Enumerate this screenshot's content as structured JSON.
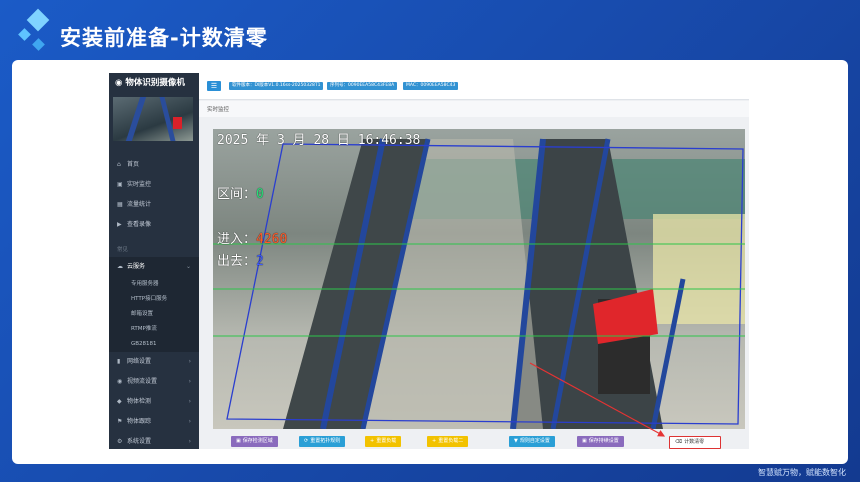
{
  "slide": {
    "title": "安装前准备-计数清零",
    "footer": "智慧赋万物，赋能数智化"
  },
  "app": {
    "brand": "物体识别摄像机",
    "brand_icon": "camera-icon",
    "nav": [
      {
        "label": "首页",
        "icon": "home-icon"
      },
      {
        "label": "实时监控",
        "icon": "monitor-icon"
      },
      {
        "label": "流量统计",
        "icon": "calendar-icon"
      },
      {
        "label": "查看录像",
        "icon": "video-icon"
      }
    ],
    "nav_group": "常见",
    "active_section": {
      "label": "云服务",
      "icon": "cloud-icon"
    },
    "sub_items": [
      "专用服务器",
      "HTTP接口服务",
      "邮箱设置",
      "RTMP推流",
      "GB28181"
    ],
    "nav_bottom": [
      {
        "label": "网络设置",
        "icon": "signal-icon"
      },
      {
        "label": "视频流设置",
        "icon": "camera-icon"
      },
      {
        "label": "物体检测",
        "icon": "shield-icon"
      },
      {
        "label": "物体跟踪",
        "icon": "flag-icon"
      },
      {
        "label": "系统设置",
        "icon": "gear-icon"
      }
    ],
    "topbar": {
      "badges": [
        "软件版本：Dl版本V1.0.16ss-20250328T1",
        "序列号：0090EEA58C43FE8A",
        "MAC：0090EEA58C43"
      ]
    },
    "breadcrumb": "实时监控",
    "video": {
      "timestamp": "2025 年 3 月 28 日   16:46:38",
      "zone_label": "区间：",
      "zone_value": "0",
      "in_label": "进入：",
      "in_value": "4260",
      "out_label": "出去：",
      "out_value": "2"
    },
    "buttons": [
      {
        "label": "保存检测区域",
        "color": "#8a6bbd",
        "icon": "save-icon"
      },
      {
        "label": "重置拓扑规则",
        "color": "#2a9fd6",
        "icon": "refresh-icon"
      },
      {
        "label": "重置负载",
        "color": "#f2c200",
        "icon": "plus-icon"
      },
      {
        "label": "重置负载二",
        "color": "#f2c200",
        "icon": "plus-icon"
      },
      {
        "label": "规则自定设置",
        "color": "#2a9fd6",
        "icon": "filter-icon"
      },
      {
        "label": "保存持续设置",
        "color": "#8a6bbd",
        "icon": "save-icon"
      },
      {
        "label": "计数清零",
        "color": "#ffffff",
        "icon": "trash-icon"
      }
    ],
    "accent": "#e53333"
  }
}
